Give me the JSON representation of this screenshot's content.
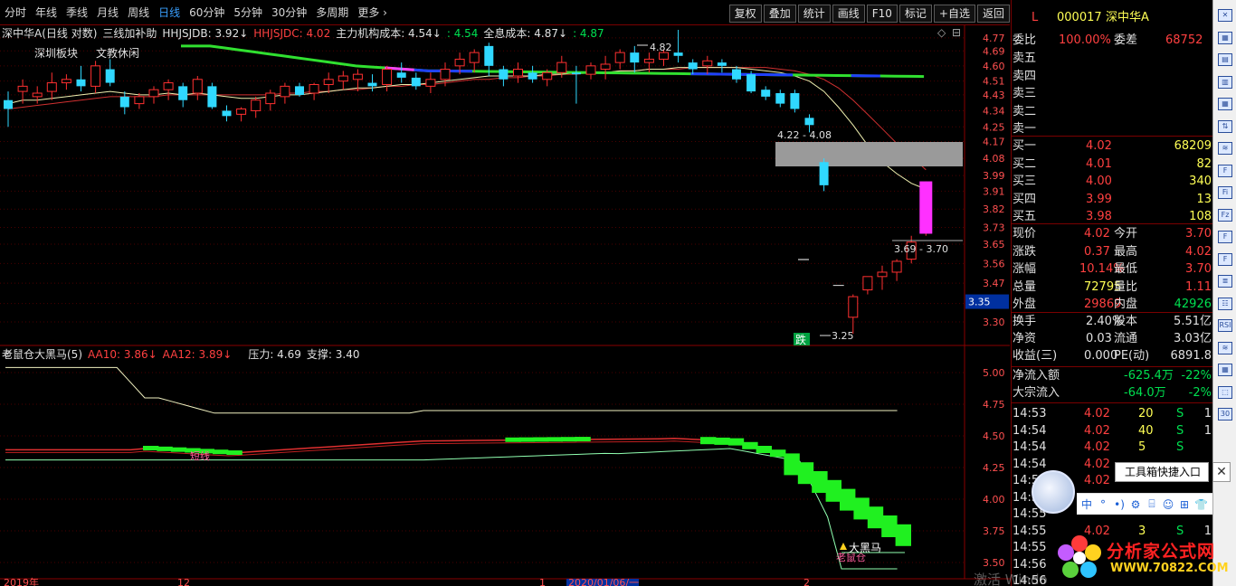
{
  "toolbar": {
    "items": [
      "分时",
      "年线",
      "季线",
      "月线",
      "周线",
      "日线",
      "60分钟",
      "5分钟",
      "30分钟",
      "多周期",
      "更多"
    ],
    "active_index": 5,
    "right_buttons": [
      "复权",
      "叠加",
      "统计",
      "画线",
      "F10",
      "标记",
      "+自选",
      "返回"
    ]
  },
  "chart_data": [
    {
      "type": "candlestick",
      "title": "深中华A(日线 对数)",
      "indicator_name": "三线加补助",
      "legend": [
        {
          "text": "HHJSJDB: 3.92",
          "color": "#e0e0e0"
        },
        {
          "text": "HHJSJDC: 4.02",
          "color": "#ff4040"
        },
        {
          "text": "主力机构成本: 4.54",
          "color": "#e0e0e0"
        },
        {
          "text": ": 4.54",
          "color": "#00e050"
        },
        {
          "text": "全息成本: 4.87",
          "color": "#e0e0e0"
        },
        {
          "text": ": 4.87",
          "color": "#00e050"
        }
      ],
      "tags": [
        "深圳板块",
        "文教休闲"
      ],
      "y_ticks": [
        4.77,
        4.69,
        4.6,
        4.51,
        4.43,
        4.34,
        4.25,
        4.17,
        4.08,
        3.99,
        3.91,
        3.82,
        3.73,
        3.65,
        3.56,
        3.47,
        3.38,
        3.3
      ],
      "current_price_tag": "3.35",
      "annotations": [
        "4.82",
        "4.22 - 4.08",
        "3.69 - 3.70",
        "3.25",
        "跌"
      ],
      "ylim": [
        3.25,
        4.82
      ],
      "candles": [
        [
          4.4,
          4.45,
          4.25,
          4.35
        ],
        [
          4.45,
          4.52,
          4.38,
          4.48
        ],
        [
          4.42,
          4.48,
          4.38,
          4.44
        ],
        [
          4.45,
          4.56,
          4.4,
          4.5
        ],
        [
          4.5,
          4.55,
          4.46,
          4.52
        ],
        [
          4.52,
          4.6,
          4.45,
          4.48
        ],
        [
          4.48,
          4.63,
          4.44,
          4.6
        ],
        [
          4.58,
          4.64,
          4.48,
          4.5
        ],
        [
          4.42,
          4.45,
          4.32,
          4.36
        ],
        [
          4.38,
          4.44,
          4.35,
          4.42
        ],
        [
          4.42,
          4.48,
          4.38,
          4.46
        ],
        [
          4.46,
          4.52,
          4.4,
          4.5
        ],
        [
          4.48,
          4.5,
          4.36,
          4.4
        ],
        [
          4.44,
          4.54,
          4.4,
          4.52
        ],
        [
          4.48,
          4.5,
          4.35,
          4.36
        ],
        [
          4.34,
          4.37,
          4.28,
          4.31
        ],
        [
          4.32,
          4.36,
          4.28,
          4.35
        ],
        [
          4.34,
          4.42,
          4.3,
          4.4
        ],
        [
          4.38,
          4.46,
          4.34,
          4.44
        ],
        [
          4.42,
          4.5,
          4.38,
          4.48
        ],
        [
          4.48,
          4.5,
          4.42,
          4.43
        ],
        [
          4.44,
          4.5,
          4.4,
          4.49
        ],
        [
          4.49,
          4.56,
          4.44,
          4.52
        ],
        [
          4.51,
          4.57,
          4.46,
          4.54
        ],
        [
          4.52,
          4.58,
          4.45,
          4.55
        ],
        [
          4.5,
          4.55,
          4.45,
          4.48
        ],
        [
          4.49,
          4.6,
          4.45,
          4.58
        ],
        [
          4.56,
          4.62,
          4.5,
          4.53
        ],
        [
          4.53,
          4.56,
          4.46,
          4.48
        ],
        [
          4.48,
          4.56,
          4.44,
          4.52
        ],
        [
          4.52,
          4.62,
          4.48,
          4.58
        ],
        [
          4.6,
          4.68,
          4.55,
          4.64
        ],
        [
          4.62,
          4.7,
          4.56,
          4.68
        ],
        [
          4.72,
          4.74,
          4.54,
          4.6
        ],
        [
          4.58,
          4.6,
          4.48,
          4.52
        ],
        [
          4.54,
          4.62,
          4.5,
          4.58
        ],
        [
          4.56,
          4.6,
          4.5,
          4.52
        ],
        [
          4.52,
          4.58,
          4.48,
          4.56
        ],
        [
          4.56,
          4.66,
          4.53,
          4.62
        ],
        [
          4.56,
          4.6,
          4.38,
          4.55
        ],
        [
          4.55,
          4.62,
          4.52,
          4.6
        ],
        [
          4.58,
          4.66,
          4.52,
          4.61
        ],
        [
          4.62,
          4.7,
          4.58,
          4.68
        ],
        [
          4.68,
          4.72,
          4.56,
          4.62
        ],
        [
          4.62,
          4.68,
          4.56,
          4.64
        ],
        [
          4.64,
          4.7,
          4.6,
          4.68
        ],
        [
          4.68,
          4.82,
          4.62,
          4.66
        ],
        [
          4.62,
          4.64,
          4.55,
          4.58
        ],
        [
          4.6,
          4.66,
          4.55,
          4.63
        ],
        [
          4.62,
          4.64,
          4.56,
          4.6
        ],
        [
          4.58,
          4.6,
          4.5,
          4.52
        ],
        [
          4.55,
          4.57,
          4.44,
          4.45
        ],
        [
          4.46,
          4.48,
          4.4,
          4.42
        ],
        [
          4.44,
          4.46,
          4.36,
          4.38
        ],
        [
          4.44,
          4.46,
          4.33,
          4.35
        ],
        [
          4.3,
          4.32,
          4.22,
          4.26
        ],
        [
          4.06,
          4.08,
          3.91,
          3.94
        ],
        [
          3.46,
          3.46,
          3.46,
          3.46
        ],
        [
          3.32,
          3.42,
          3.25,
          3.41
        ],
        [
          3.44,
          3.5,
          3.42,
          3.5
        ],
        [
          3.5,
          3.55,
          3.44,
          3.52
        ],
        [
          3.52,
          3.58,
          3.48,
          3.57
        ],
        [
          3.58,
          3.69,
          3.56,
          3.66
        ],
        [
          3.7,
          3.96,
          3.69,
          3.96
        ]
      ],
      "ma_white": [
        4.38,
        4.4,
        4.4,
        4.41,
        4.42,
        4.43,
        4.44,
        4.45,
        4.44,
        4.43,
        4.43,
        4.44,
        4.43,
        4.44,
        4.43,
        4.42,
        4.41,
        4.41,
        4.42,
        4.43,
        4.43,
        4.44,
        4.45,
        4.46,
        4.47,
        4.47,
        4.48,
        4.49,
        4.49,
        4.5,
        4.51,
        4.52,
        4.53,
        4.54,
        4.54,
        4.54,
        4.54,
        4.55,
        4.55,
        4.56,
        4.56,
        4.56,
        4.57,
        4.57,
        4.58,
        4.58,
        4.59,
        4.59,
        4.59,
        4.59,
        4.59,
        4.58,
        4.57,
        4.56,
        4.54,
        4.51,
        4.45,
        4.36,
        4.26,
        4.15,
        4.06,
        4.0,
        3.95,
        3.92
      ],
      "ma_red": [
        4.35,
        4.36,
        4.37,
        4.38,
        4.39,
        4.4,
        4.41,
        4.42,
        4.42,
        4.42,
        4.42,
        4.43,
        4.43,
        4.43,
        4.43,
        4.43,
        4.43,
        4.43,
        4.43,
        4.44,
        4.44,
        4.45,
        4.45,
        4.46,
        4.46,
        4.47,
        4.48,
        4.48,
        4.49,
        4.49,
        4.5,
        4.51,
        4.52,
        4.52,
        4.53,
        4.53,
        4.54,
        4.54,
        4.55,
        4.55,
        4.56,
        4.56,
        4.57,
        4.57,
        4.58,
        4.58,
        4.58,
        4.59,
        4.59,
        4.59,
        4.59,
        4.59,
        4.59,
        4.58,
        4.57,
        4.55,
        4.52,
        4.47,
        4.4,
        4.32,
        4.24,
        4.16,
        4.09,
        4.02
      ]
    },
    {
      "type": "indicator",
      "title": "老鼠仓大黑马(5)",
      "legend": [
        {
          "text": "AA10: 3.86",
          "color": "#ff4040"
        },
        {
          "text": "AA12: 3.89",
          "color": "#ff4040"
        },
        {
          "text": "压力: 4.69",
          "color": "#e0e0e0"
        },
        {
          "text": "支撑: 3.40",
          "color": "#e0e0e0"
        }
      ],
      "y_ticks": [
        5.0,
        4.75,
        4.5,
        4.25,
        4.0,
        3.75,
        3.5
      ],
      "annotations": [
        "短线",
        "大黑马",
        "老鼠仓"
      ],
      "ylim": [
        3.4,
        5.1
      ]
    }
  ],
  "x_labels": [
    "2019年",
    "12",
    "1",
    "2020/01/06/一",
    "2"
  ],
  "quote_panel": {
    "code": "000017",
    "name": "深中华A",
    "l_badge": "L",
    "weibi_label": "委比",
    "weibi_value": "100.00%",
    "weicha_label": "委差",
    "weicha_value": "68752",
    "sell_labels": [
      "卖五",
      "卖四",
      "卖三",
      "卖二",
      "卖一"
    ],
    "buy_levels": [
      {
        "label": "买一",
        "price": "4.02",
        "vol": "68209"
      },
      {
        "label": "买二",
        "price": "4.01",
        "vol": "82"
      },
      {
        "label": "买三",
        "price": "4.00",
        "vol": "340"
      },
      {
        "label": "买四",
        "price": "3.99",
        "vol": "13"
      },
      {
        "label": "买五",
        "price": "3.98",
        "vol": "108"
      }
    ],
    "stats": [
      {
        "l1": "现价",
        "v1": "4.02",
        "c1": "#ff4040",
        "l2": "今开",
        "v2": "3.70",
        "c2": "#ff4040"
      },
      {
        "l1": "涨跌",
        "v1": "0.37",
        "c1": "#ff4040",
        "l2": "最高",
        "v2": "4.02",
        "c2": "#ff4040"
      },
      {
        "l1": "涨幅",
        "v1": "10.14%",
        "c1": "#ff4040",
        "l2": "最低",
        "v2": "3.70",
        "c2": "#ff4040"
      },
      {
        "l1": "总量",
        "v1": "72795",
        "c1": "#ffff55",
        "l2": "量比",
        "v2": "1.11",
        "c2": "#ff4040"
      },
      {
        "l1": "外盘",
        "v1": "29869",
        "c1": "#ff4040",
        "l2": "内盘",
        "v2": "42926",
        "c2": "#00e050"
      }
    ],
    "stats2": [
      {
        "l1": "换手",
        "v1": "2.40%",
        "l2": "股本",
        "v2": "5.51亿"
      },
      {
        "l1": "净资",
        "v1": "0.03",
        "l2": "流通",
        "v2": "3.03亿"
      },
      {
        "l1": "收益(三)",
        "v1": "0.000",
        "l2": "PE(动)",
        "v2": "6891.8"
      }
    ],
    "flows": [
      {
        "l": "净流入额",
        "v": "-625.4万",
        "p": "-22%"
      },
      {
        "l": "大宗流入",
        "v": "-64.0万",
        "p": "-2%"
      }
    ],
    "ticks": [
      {
        "t": "14:53",
        "p": "4.02",
        "v": "20",
        "s": "S",
        "n": "1"
      },
      {
        "t": "14:54",
        "p": "4.02",
        "v": "40",
        "s": "S",
        "n": "1"
      },
      {
        "t": "14:54",
        "p": "4.02",
        "v": "5",
        "s": "S",
        "n": ""
      },
      {
        "t": "14:54",
        "p": "4.02",
        "v": "",
        "s": "",
        "n": ""
      },
      {
        "t": "14:5",
        "p": "4.02",
        "v": "",
        "s": "",
        "n": ""
      },
      {
        "t": "14:5",
        "p": "",
        "v": "",
        "s": "",
        "n": ""
      },
      {
        "t": "14:55",
        "p": "",
        "v": "",
        "s": "",
        "n": ""
      },
      {
        "t": "14:55",
        "p": "4.02",
        "v": "3",
        "s": "S",
        "n": "1"
      },
      {
        "t": "14:55",
        "p": "",
        "v": "",
        "s": "",
        "n": ""
      },
      {
        "t": "14:56",
        "p": "",
        "v": "",
        "s": "",
        "n": ""
      },
      {
        "t": "14:56",
        "p": "",
        "v": "",
        "s": "",
        "n": ""
      }
    ]
  },
  "tooltip": "工具箱快捷入口",
  "tool_strip": [
    "中",
    "°",
    "•)",
    "⚙",
    "⌸",
    "☺",
    "⊞",
    "👕"
  ],
  "sidebar_icons": [
    "✕",
    "▦",
    "▤",
    "▥",
    "▦",
    "⇅",
    "≋",
    "F",
    "Fi",
    "Fz",
    "F",
    "F",
    "≣",
    "☷",
    "RSI",
    "≋",
    "▦",
    "⬚",
    "30"
  ],
  "watermark": {
    "line1": "分析家公式网",
    "line2": "WWW.70822.COM"
  },
  "overlay_text": "激活 Windo"
}
